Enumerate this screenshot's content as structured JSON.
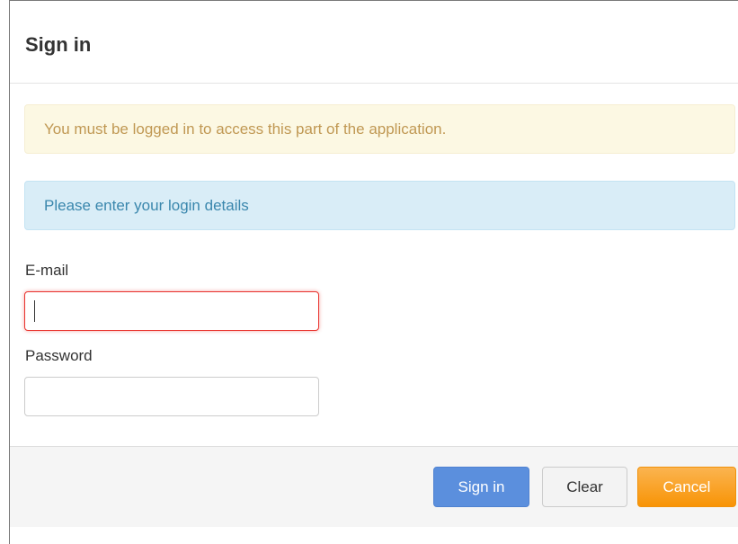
{
  "header": {
    "title": "Sign in"
  },
  "alerts": {
    "warning": "You must be logged in to access this part of the application.",
    "info": "Please enter your login details"
  },
  "form": {
    "email": {
      "label": "E-mail",
      "value": "",
      "placeholder": ""
    },
    "password": {
      "label": "Password",
      "value": "",
      "placeholder": ""
    }
  },
  "footer": {
    "sign_in_label": "Sign in",
    "clear_label": "Clear",
    "cancel_label": "Cancel"
  },
  "colors": {
    "primary": "#5b8fdd",
    "warning": "#f89406",
    "error_border": "#e9322d",
    "alert_warning_bg": "#fcf8e3",
    "alert_info_bg": "#d9edf7"
  }
}
